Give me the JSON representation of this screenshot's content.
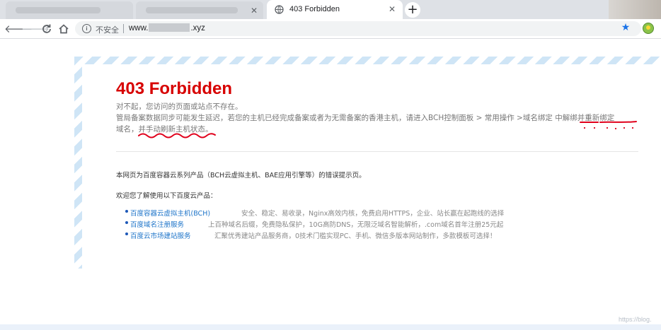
{
  "browser": {
    "active_tab_title": "403 Forbidden",
    "new_tab": "+",
    "security_label": "不安全",
    "url_prefix": "www.",
    "url_suffix": ".xyz",
    "accent": "#1a73e8"
  },
  "page": {
    "heading": "403 Forbidden",
    "heading_color": "#d70000",
    "line1": "对不起，您访问的页面或站点不存在。",
    "line2": "管局备案数据同步可能发生延迟，若您的主机已经完成备案或者为无需备案的香港主机，请进入BCH控制面板 > 常用操作 >域名绑定 中解绑并重新绑定",
    "line3": "域名，并手动刷新主机状态。",
    "note": "本网页为百度容器云系列产品（BCH云虚拟主机、BAE应用引擎等）的错误提示页。",
    "intro": "欢迎您了解使用以下百度云产品：",
    "products": [
      {
        "name": "百度容器云虚拟主机(BCH)",
        "desc": "安全、稳定、易收录，Nginx高效内核，免费启用HTTPS，企业、站长赢在起跑线的选择"
      },
      {
        "name": "百度域名注册服务",
        "desc": "上百种域名后缀，免费隐私保护，10G高防DNS，无限泛域名智能解析，.com域名首年注册25元起"
      },
      {
        "name": "百度云市场建站服务",
        "desc": "汇聚优秀建站产品服务商，0技术门槛实现PC、手机、微信多版本网站制作，多款模板可选择！"
      }
    ],
    "link_color": "#1d74c9"
  },
  "watermark": "https://blog."
}
